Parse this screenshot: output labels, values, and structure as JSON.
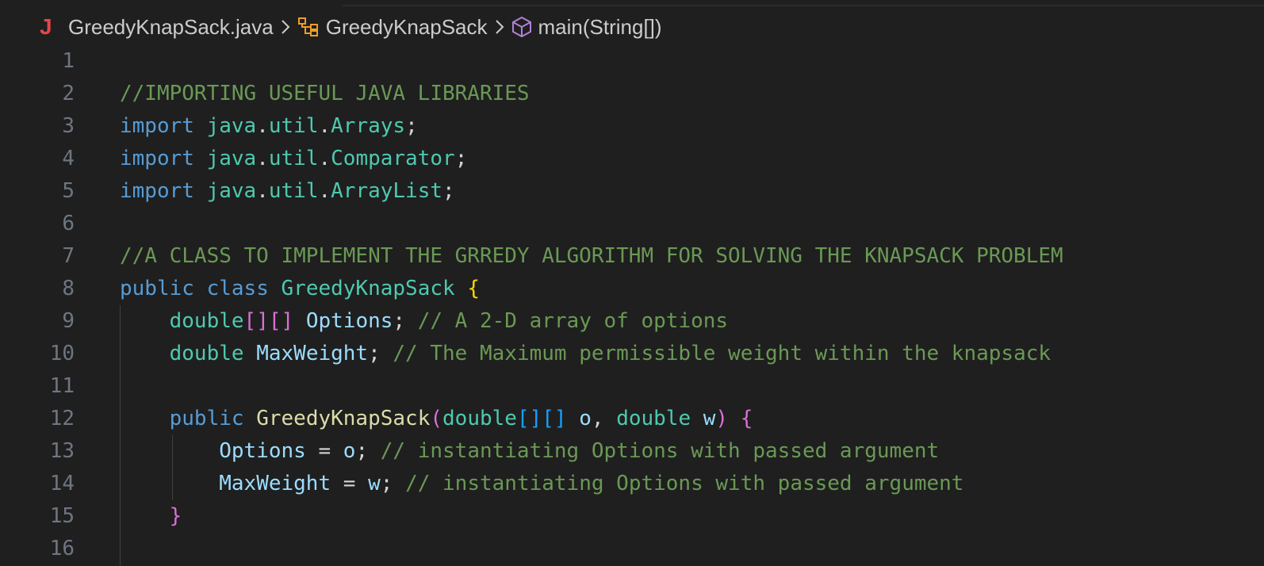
{
  "breadcrumb": {
    "file_icon": "J",
    "file_name": "GreedyKnapSack.java",
    "class_name": "GreedyKnapSack",
    "method_name": "main(String[])"
  },
  "icons": {
    "file": "java-file-icon",
    "separator": "chevron-right-icon",
    "class": "class-symbol-icon",
    "method": "method-cube-icon"
  },
  "colors": {
    "background": "#1f1f1f",
    "comment": "#6a9955",
    "keyword": "#569cd6",
    "type": "#4ec9b0",
    "variable": "#9cdcfe",
    "function": "#dcdcaa",
    "brace_yellow": "#ffd700",
    "brace_pink": "#da70d6",
    "brace_blue": "#179fff",
    "line_number": "#6e7681",
    "java_icon": "#e2474a",
    "class_icon": "#ee9d28",
    "method_icon": "#b180d7"
  },
  "editor": {
    "line_numbers": [
      "1",
      "2",
      "3",
      "4",
      "5",
      "6",
      "7",
      "8",
      "9",
      "10",
      "11",
      "12",
      "13",
      "14",
      "15",
      "16"
    ],
    "lines": [
      {
        "tokens": []
      },
      {
        "tokens": [
          {
            "t": "comment",
            "v": "//IMPORTING USEFUL JAVA LIBRARIES"
          }
        ]
      },
      {
        "tokens": [
          {
            "t": "kw",
            "v": "import"
          },
          {
            "t": "plain",
            "v": " "
          },
          {
            "t": "type",
            "v": "java"
          },
          {
            "t": "plain",
            "v": "."
          },
          {
            "t": "type",
            "v": "util"
          },
          {
            "t": "plain",
            "v": "."
          },
          {
            "t": "type",
            "v": "Arrays"
          },
          {
            "t": "plain",
            "v": ";"
          }
        ]
      },
      {
        "tokens": [
          {
            "t": "kw",
            "v": "import"
          },
          {
            "t": "plain",
            "v": " "
          },
          {
            "t": "type",
            "v": "java"
          },
          {
            "t": "plain",
            "v": "."
          },
          {
            "t": "type",
            "v": "util"
          },
          {
            "t": "plain",
            "v": "."
          },
          {
            "t": "type",
            "v": "Comparator"
          },
          {
            "t": "plain",
            "v": ";"
          }
        ]
      },
      {
        "tokens": [
          {
            "t": "kw",
            "v": "import"
          },
          {
            "t": "plain",
            "v": " "
          },
          {
            "t": "type",
            "v": "java"
          },
          {
            "t": "plain",
            "v": "."
          },
          {
            "t": "type",
            "v": "util"
          },
          {
            "t": "plain",
            "v": "."
          },
          {
            "t": "type",
            "v": "ArrayList"
          },
          {
            "t": "plain",
            "v": ";"
          }
        ]
      },
      {
        "tokens": []
      },
      {
        "tokens": [
          {
            "t": "comment",
            "v": "//A CLASS TO IMPLEMENT THE GRREDY ALGORITHM FOR SOLVING THE KNAPSACK PROBLEM"
          }
        ]
      },
      {
        "tokens": [
          {
            "t": "kw",
            "v": "public"
          },
          {
            "t": "plain",
            "v": " "
          },
          {
            "t": "kw",
            "v": "class"
          },
          {
            "t": "plain",
            "v": " "
          },
          {
            "t": "type",
            "v": "GreedyKnapSack"
          },
          {
            "t": "plain",
            "v": " "
          },
          {
            "t": "brace-y",
            "v": "{"
          }
        ]
      },
      {
        "tokens": [
          {
            "t": "plain",
            "v": "    "
          },
          {
            "t": "type",
            "v": "double"
          },
          {
            "t": "brace-p",
            "v": "[][]"
          },
          {
            "t": "plain",
            "v": " "
          },
          {
            "t": "var",
            "v": "Options"
          },
          {
            "t": "plain",
            "v": "; "
          },
          {
            "t": "comment",
            "v": "// A 2-D array of options"
          }
        ]
      },
      {
        "tokens": [
          {
            "t": "plain",
            "v": "    "
          },
          {
            "t": "type",
            "v": "double"
          },
          {
            "t": "plain",
            "v": " "
          },
          {
            "t": "var",
            "v": "MaxWeight"
          },
          {
            "t": "plain",
            "v": "; "
          },
          {
            "t": "comment",
            "v": "// The Maximum permissible weight within the knapsack"
          }
        ]
      },
      {
        "tokens": []
      },
      {
        "tokens": [
          {
            "t": "plain",
            "v": "    "
          },
          {
            "t": "kw",
            "v": "public"
          },
          {
            "t": "plain",
            "v": " "
          },
          {
            "t": "fn",
            "v": "GreedyKnapSack"
          },
          {
            "t": "brace-p",
            "v": "("
          },
          {
            "t": "type",
            "v": "double"
          },
          {
            "t": "brace-b",
            "v": "[][]"
          },
          {
            "t": "plain",
            "v": " "
          },
          {
            "t": "var",
            "v": "o"
          },
          {
            "t": "plain",
            "v": ", "
          },
          {
            "t": "type",
            "v": "double"
          },
          {
            "t": "plain",
            "v": " "
          },
          {
            "t": "var",
            "v": "w"
          },
          {
            "t": "brace-p",
            "v": ")"
          },
          {
            "t": "plain",
            "v": " "
          },
          {
            "t": "brace-p",
            "v": "{"
          }
        ]
      },
      {
        "tokens": [
          {
            "t": "plain",
            "v": "        "
          },
          {
            "t": "var",
            "v": "Options"
          },
          {
            "t": "plain",
            "v": " = "
          },
          {
            "t": "var",
            "v": "o"
          },
          {
            "t": "plain",
            "v": "; "
          },
          {
            "t": "comment",
            "v": "// instantiating Options with passed argument"
          }
        ]
      },
      {
        "tokens": [
          {
            "t": "plain",
            "v": "        "
          },
          {
            "t": "var",
            "v": "MaxWeight"
          },
          {
            "t": "plain",
            "v": " = "
          },
          {
            "t": "var",
            "v": "w"
          },
          {
            "t": "plain",
            "v": "; "
          },
          {
            "t": "comment",
            "v": "// instantiating Options with passed argument"
          }
        ]
      },
      {
        "tokens": [
          {
            "t": "plain",
            "v": "    "
          },
          {
            "t": "brace-p",
            "v": "}"
          }
        ]
      },
      {
        "tokens": []
      }
    ]
  }
}
